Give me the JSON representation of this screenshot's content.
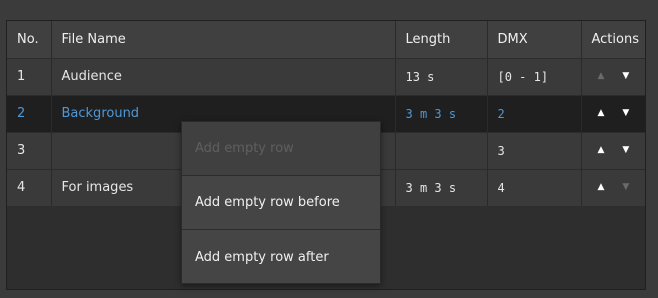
{
  "table": {
    "headers": {
      "no": "No.",
      "file_name": "File Name",
      "length": "Length",
      "dmx": "DMX",
      "actions": "Actions"
    },
    "rows": [
      {
        "no": "1",
        "file_name": "Audience",
        "length": "13 s",
        "dmx": "[0 - 1]",
        "selected": false,
        "up_enabled": false,
        "down_enabled": true
      },
      {
        "no": "2",
        "file_name": "Background",
        "length": "3 m 3 s",
        "dmx": "2",
        "selected": true,
        "up_enabled": true,
        "down_enabled": true
      },
      {
        "no": "3",
        "file_name": "",
        "length": "",
        "dmx": "3",
        "selected": false,
        "up_enabled": true,
        "down_enabled": true
      },
      {
        "no": "4",
        "file_name": "For images",
        "length": "3 m 3 s",
        "dmx": "4",
        "selected": false,
        "up_enabled": true,
        "down_enabled": false
      }
    ]
  },
  "context_menu": {
    "items": [
      {
        "label": "Add empty row",
        "disabled": true
      },
      {
        "label": "Add empty row before",
        "disabled": false
      },
      {
        "label": "Add empty row after",
        "disabled": false
      }
    ]
  },
  "colors": {
    "selected_text": "#4f98d6",
    "header_bg": "#404040",
    "row_bg": "#3a3a3a",
    "selected_row_bg": "#1f1f1f"
  },
  "icons": {
    "up": "▲",
    "down": "▼"
  }
}
